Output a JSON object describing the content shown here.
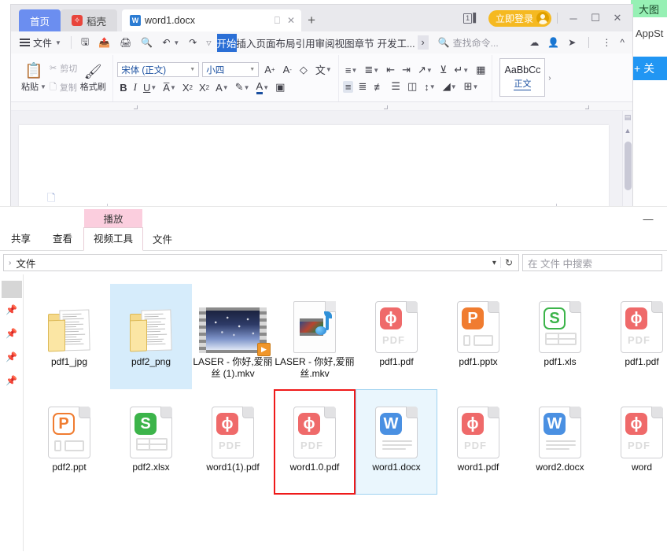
{
  "background_app": {
    "badge_label": "大图",
    "appstore_label": "AppSt",
    "blue_button_label": "+ 关"
  },
  "wps": {
    "tabs": [
      {
        "label": "首页",
        "icon": "home-icon",
        "active": true
      },
      {
        "label": "稻壳",
        "icon": "daoke-icon",
        "active": false
      },
      {
        "label": "word1.docx",
        "icon": "word-doc-icon",
        "active": false
      }
    ],
    "tab_new_label": "+",
    "tab_restore_icon": "restore-icon",
    "tab_close_icon": "close-icon",
    "doc_count": "1",
    "login_label": "立即登录",
    "window_buttons": {
      "minimize": "─",
      "maximize": "☐",
      "close": "✕"
    },
    "command_row": {
      "file_menu_label": "文件",
      "quick_icons": [
        "save-icon",
        "save-as-icon",
        "print-icon",
        "print-preview-icon",
        "undo-icon",
        "redo-icon",
        "customize-icon"
      ],
      "ribbon_tabs": [
        "开始",
        "插入",
        "页面布局",
        "引用",
        "审阅",
        "视图",
        "章节",
        "开发工..."
      ],
      "ribbon_active_tab": "开始",
      "ribbon_more": "›",
      "find_placeholder": "查找命令...",
      "right_icons": [
        "cloud-sync-icon",
        "share-user-icon",
        "share-icon",
        "more-vertical-icon",
        "collapse-ribbon-icon"
      ]
    },
    "ribbon": {
      "paste_label": "粘贴",
      "cut_label": "剪切",
      "copy_label": "复制",
      "format_painter_label": "格式刷",
      "font_family": "宋体 (正文)",
      "font_size": "小四",
      "font_icons": [
        "grow-font-icon",
        "shrink-font-icon",
        "clear-format-icon",
        "pinyin-guide-icon"
      ],
      "style_buttons": [
        "B",
        "I",
        "U",
        "A",
        "X²",
        "X₂",
        "A",
        "highlight-icon",
        "font-color-icon",
        "text-box-icon"
      ],
      "para_icons_row1": [
        "bullet-list-icon",
        "number-list-icon",
        "decrease-indent-icon",
        "increase-indent-icon",
        "multilevel-list-icon",
        "sort-icon",
        "show-marks-icon",
        "ruler-icon"
      ],
      "para_icons_row2": [
        "align-left-icon",
        "align-center-icon",
        "align-right-icon",
        "justify-icon",
        "distribute-icon",
        "line-spacing-icon",
        "shading-icon",
        "borders-icon"
      ],
      "style_gallery": {
        "sample": "AaBbCc",
        "name": "正文",
        "expand": "›"
      }
    }
  },
  "explorer": {
    "ribbon_tabs": [
      {
        "label": "共享"
      },
      {
        "label": "查看"
      },
      {
        "label": "视频工具",
        "group_header": "播放",
        "contextual": true
      },
      {
        "label": "文件"
      }
    ],
    "minimize_icon": "minimize-icon",
    "address": {
      "chevron": "›",
      "path": "文件",
      "dropdown_icon": "chevron-down-icon",
      "refresh_icon": "refresh-icon"
    },
    "search": {
      "placeholder": "在 文件 中搜索"
    },
    "navpane": {
      "items": [
        "selected-block",
        "pin-icon",
        "pin-icon",
        "pin-icon",
        "pin-icon"
      ]
    },
    "files": [
      {
        "name": "pdf1_jpg",
        "type": "folder",
        "state": "normal"
      },
      {
        "name": "pdf2_png",
        "type": "folder",
        "state": "selected"
      },
      {
        "name": "LASER - 你好,爱丽丝 (1).mkv",
        "type": "video-thumbnail",
        "state": "normal"
      },
      {
        "name": "LASER - 你好,爱丽丝.mkv",
        "type": "media-file",
        "state": "normal"
      },
      {
        "name": "pdf1.pdf",
        "type": "pdf",
        "state": "normal"
      },
      {
        "name": "pdf1.pptx",
        "type": "ppt",
        "state": "normal"
      },
      {
        "name": "pdf1.xls",
        "type": "xls-outline",
        "state": "normal"
      },
      {
        "name": "pdf1.pdf",
        "type": "pdf",
        "state": "clipped"
      },
      {
        "name": "pdf2.ppt",
        "type": "ppt-outline",
        "state": "normal"
      },
      {
        "name": "pdf2.xlsx",
        "type": "xls",
        "state": "normal"
      },
      {
        "name": "word1(1).pdf",
        "type": "pdf",
        "state": "normal"
      },
      {
        "name": "word1.0.pdf",
        "type": "pdf",
        "state": "redbox"
      },
      {
        "name": "word1.docx",
        "type": "docx",
        "state": "sel-outline"
      },
      {
        "name": "word1.pdf",
        "type": "pdf",
        "state": "normal"
      },
      {
        "name": "word2.docx",
        "type": "docx",
        "state": "normal"
      },
      {
        "name": "word",
        "type": "pdf",
        "state": "clipped"
      }
    ],
    "colors": {
      "pdf_red": "#ef6a6a",
      "ppt_orange": "#f07c30",
      "xls_green": "#3cb44a",
      "doc_blue": "#4a90e2",
      "selection_blue": "#d6ecfb",
      "highlight_red": "#ef1a1a",
      "contextual_pink": "#fbcede"
    }
  }
}
